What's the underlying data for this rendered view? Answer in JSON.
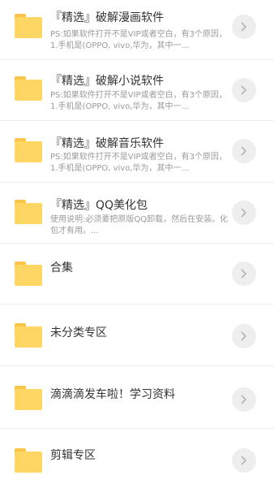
{
  "items": [
    {
      "title": "『精选』破解漫画软件",
      "desc": "PS:如果软件打开不是VIP或者空白，有3个原因，1.手机是(OPPO, vivo,华为，其中一…"
    },
    {
      "title": "『精选』破解小说软件",
      "desc": "PS:如果软件打开不是VIP或者空白，有3个原因，1.手机是(OPPO, vivo,华为，其中一…"
    },
    {
      "title": "『精选』破解音乐软件",
      "desc": "PS:如果软件打开不是VIP或者空白，有3个原因，1.手机是(OPPO, vivo,华为，其中一…"
    },
    {
      "title": "『精选』QQ美化包",
      "desc": "使用说明:必须要把原版QQ卸载，然后在安装。化包才有用。..."
    },
    {
      "title": "合集"
    },
    {
      "title": "未分类专区"
    },
    {
      "title": "滴滴滴发车啦！学习资料"
    },
    {
      "title": "剪辑专区"
    }
  ],
  "icons": {
    "folder": "folder-icon",
    "arrow": "chevron-right-icon"
  },
  "colors": {
    "folder": "#fdd663",
    "folder_tab": "#f9c64a",
    "arrow_bg": "#eeeeee",
    "arrow_fg": "#b5b5b5",
    "title": "#333333",
    "desc": "#9a9a9a"
  }
}
